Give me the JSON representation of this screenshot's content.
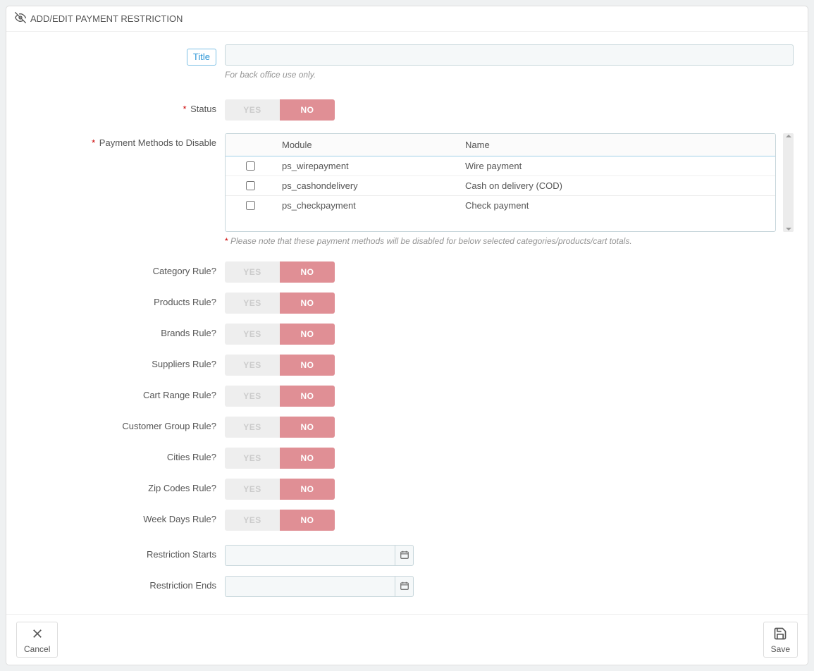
{
  "panel": {
    "title": "ADD/EDIT PAYMENT RESTRICTION"
  },
  "title_field": {
    "label": "Title",
    "help": "For back office use only."
  },
  "status": {
    "label": "Status",
    "yes": "YES",
    "no": "NO"
  },
  "payment_methods": {
    "label": "Payment Methods to Disable",
    "col_module": "Module",
    "col_name": "Name",
    "rows": [
      {
        "module": "ps_wirepayment",
        "name": "Wire payment"
      },
      {
        "module": "ps_cashondelivery",
        "name": "Cash on delivery (COD)"
      },
      {
        "module": "ps_checkpayment",
        "name": "Check payment"
      }
    ],
    "help": "Please note that these payment methods will be disabled for below selected categories/products/cart totals."
  },
  "rules": [
    {
      "id": "category",
      "label": "Category Rule?"
    },
    {
      "id": "products",
      "label": "Products Rule?"
    },
    {
      "id": "brands",
      "label": "Brands Rule?"
    },
    {
      "id": "suppliers",
      "label": "Suppliers Rule?"
    },
    {
      "id": "cartrange",
      "label": "Cart Range Rule?"
    },
    {
      "id": "customergroup",
      "label": "Customer Group Rule?"
    },
    {
      "id": "cities",
      "label": "Cities Rule?"
    },
    {
      "id": "zipcodes",
      "label": "Zip Codes Rule?"
    },
    {
      "id": "weekdays",
      "label": "Week Days Rule?"
    }
  ],
  "toggle": {
    "yes": "YES",
    "no": "NO"
  },
  "restriction_starts": {
    "label": "Restriction Starts"
  },
  "restriction_ends": {
    "label": "Restriction Ends"
  },
  "footer": {
    "cancel": "Cancel",
    "save": "Save"
  }
}
